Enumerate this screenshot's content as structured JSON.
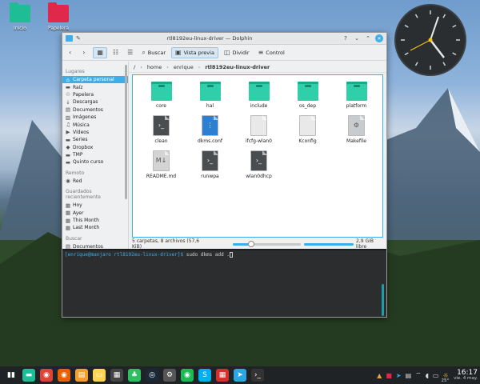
{
  "desktop": {
    "icons": [
      {
        "label": "Inicio",
        "icon": "home-folder-icon",
        "color": "#1fbd96"
      },
      {
        "label": "Papelera",
        "icon": "trash-folder-icon",
        "color": "#e0284a"
      }
    ]
  },
  "window": {
    "title": "rtl8192eu-linux-driver — Dolphin",
    "toolbar": {
      "search_label": "Buscar",
      "preview_label": "Vista previa",
      "split_label": "Dividir",
      "control_label": "Control"
    },
    "breadcrumb": [
      "/",
      "home",
      "enrique",
      "rtl8192eu-linux-driver"
    ],
    "sidebar": {
      "sections": [
        {
          "title": "Lugares",
          "items": [
            {
              "label": "Carpeta personal",
              "icon": "home-icon",
              "selected": true
            },
            {
              "label": "Raíz",
              "icon": "folder-red-icon"
            },
            {
              "label": "Papelera",
              "icon": "trash-icon"
            },
            {
              "label": "Descargas",
              "icon": "download-icon"
            },
            {
              "label": "Documentos",
              "icon": "documents-icon"
            },
            {
              "label": "Imágenes",
              "icon": "pictures-icon"
            },
            {
              "label": "Música",
              "icon": "music-icon"
            },
            {
              "label": "Vídeos",
              "icon": "videos-icon"
            },
            {
              "label": "Series",
              "icon": "folder-icon"
            },
            {
              "label": "Dropbox",
              "icon": "dropbox-icon"
            },
            {
              "label": "TMP",
              "icon": "folder-icon"
            },
            {
              "label": "Quinto curso",
              "icon": "folder-icon"
            }
          ]
        },
        {
          "title": "Remoto",
          "items": [
            {
              "label": "Red",
              "icon": "network-icon"
            }
          ]
        },
        {
          "title": "Guardados recientemente",
          "items": [
            {
              "label": "Hoy",
              "icon": "calendar-icon"
            },
            {
              "label": "Ayer",
              "icon": "calendar-icon"
            },
            {
              "label": "This Month",
              "icon": "calendar-icon"
            },
            {
              "label": "Last Month",
              "icon": "calendar-icon"
            }
          ]
        },
        {
          "title": "Buscar",
          "items": [
            {
              "label": "Documentos",
              "icon": "documents-icon"
            }
          ]
        }
      ]
    },
    "files": [
      {
        "name": "core",
        "type": "folder"
      },
      {
        "name": "hal",
        "type": "folder"
      },
      {
        "name": "include",
        "type": "folder"
      },
      {
        "name": "os_dep",
        "type": "folder"
      },
      {
        "name": "platform",
        "type": "folder"
      },
      {
        "name": "clean",
        "type": "script"
      },
      {
        "name": "dkms.conf",
        "type": "archive"
      },
      {
        "name": "ifcfg-wlan0",
        "type": "text"
      },
      {
        "name": "Kconfig",
        "type": "text"
      },
      {
        "name": "Makefile",
        "type": "makefile"
      },
      {
        "name": "README.md",
        "type": "markdown"
      },
      {
        "name": "runwpa",
        "type": "script"
      },
      {
        "name": "wlan0dhcp",
        "type": "script"
      }
    ],
    "status": {
      "summary": "5 carpetas, 8 archivos (57,6 KiB)",
      "zoom_fraction": 0.27,
      "free_space": "2,9 GiB libre",
      "used_fraction": 0.95
    },
    "terminal": {
      "prompt": "[enrique@manjaro rtl8192eu-linux-driver]$",
      "command": "sudo dkms add ."
    }
  },
  "taskbar": {
    "apps": [
      "app-launcher-icon",
      "file-manager-icon",
      "chrome-icon",
      "firefox-icon",
      "files-icon",
      "notes-icon",
      "calculator-icon",
      "evernote-icon",
      "steam-icon",
      "settings-icon",
      "spotify-icon",
      "skype-icon",
      "calendar-icon",
      "telegram-icon",
      "terminal-icon"
    ],
    "time": "16:17",
    "date": "vie. 4 may.",
    "temperature": "25°"
  },
  "colors": {
    "accent": "#3daee9",
    "folder": "#2ecfa9",
    "taskbar": "#1f2325"
  }
}
